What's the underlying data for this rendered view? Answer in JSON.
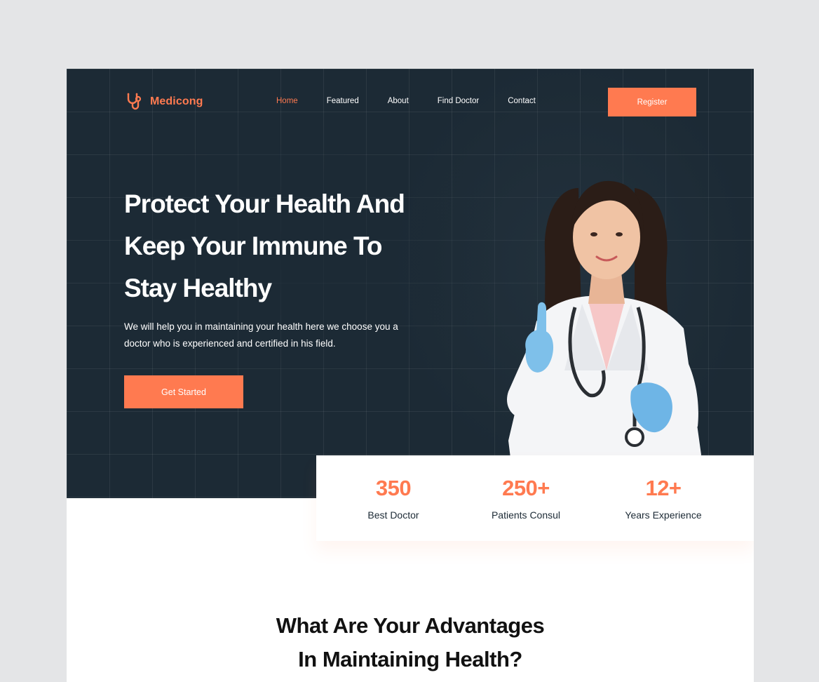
{
  "brand": {
    "name": "Medicong",
    "accent": "#ff7a50",
    "dark": "#1c2a35"
  },
  "nav": {
    "items": [
      {
        "label": "Home",
        "active": true
      },
      {
        "label": "Featured",
        "active": false
      },
      {
        "label": "About",
        "active": false
      },
      {
        "label": "Find Doctor",
        "active": false
      },
      {
        "label": "Contact",
        "active": false
      }
    ],
    "register_label": "Register"
  },
  "hero": {
    "headline_lines": [
      "Protect Your Health And",
      "Keep Your Immune To",
      "Stay Healthy"
    ],
    "subtext_lines": [
      "We will help you in maintaining your health here we choose you a",
      "doctor who is experienced and certified in his field."
    ],
    "cta_label": "Get Started"
  },
  "stats": [
    {
      "value": "350",
      "label": "Best Doctor"
    },
    {
      "value": "250+",
      "label": "Patients Consul"
    },
    {
      "value": "12+",
      "label": "Years Experience"
    }
  ],
  "advantages": {
    "title_lines": [
      "What Are Your Advantages",
      "In Maintaining Health?"
    ]
  }
}
